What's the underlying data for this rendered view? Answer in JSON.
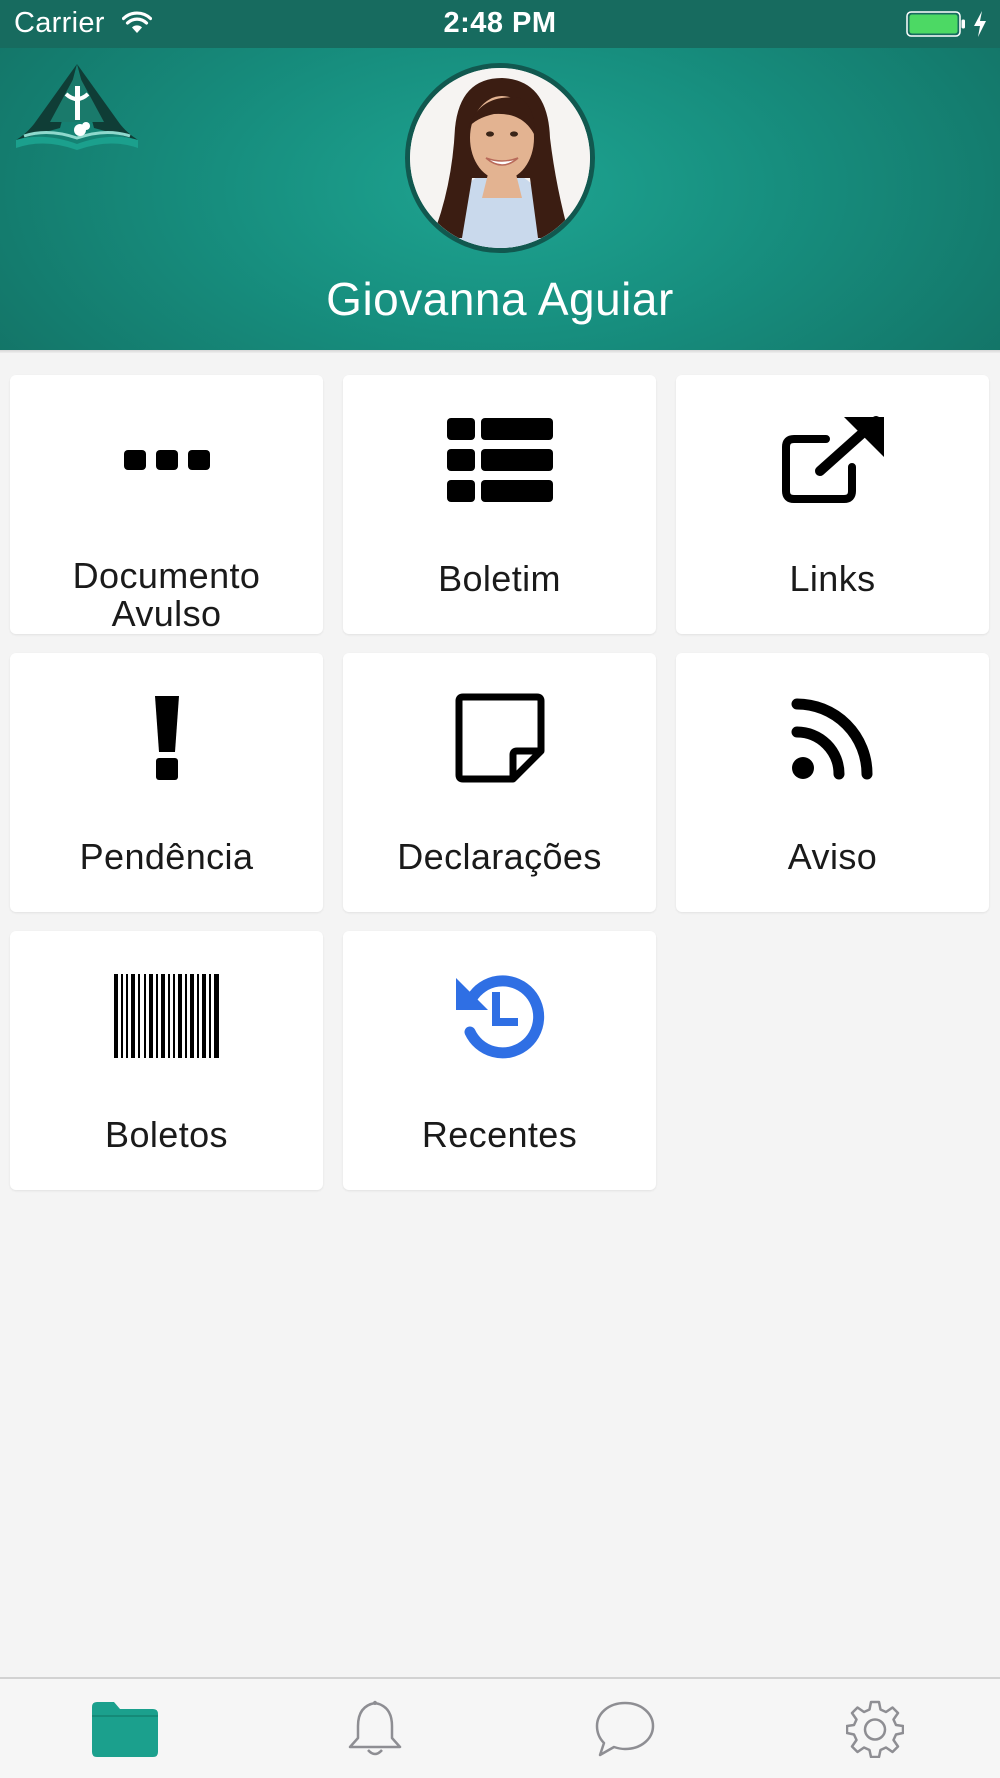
{
  "status_bar": {
    "carrier": "Carrier",
    "time": "2:48 PM"
  },
  "header": {
    "user_name": "Giovanna Aguiar",
    "logo_icon": "school-logo-icon",
    "avatar": "user-avatar-photo"
  },
  "menu": {
    "items": [
      {
        "label": "Documento Avulso",
        "icon": "more-dots-icon"
      },
      {
        "label": "Boletim",
        "icon": "list-icon"
      },
      {
        "label": "Links",
        "icon": "external-link-icon"
      },
      {
        "label": "Pendência",
        "icon": "exclamation-icon"
      },
      {
        "label": "Declarações",
        "icon": "sticky-note-icon"
      },
      {
        "label": "Aviso",
        "icon": "rss-feed-icon"
      },
      {
        "label": "Boletos",
        "icon": "barcode-icon"
      },
      {
        "label": "Recentes",
        "icon": "history-icon"
      }
    ]
  },
  "tab_bar": {
    "tabs": [
      {
        "icon": "folder-icon",
        "active": true
      },
      {
        "icon": "bell-icon",
        "active": false
      },
      {
        "icon": "chat-bubble-icon",
        "active": false
      },
      {
        "icon": "gear-icon",
        "active": false
      }
    ]
  },
  "colors": {
    "header": "#178f7f",
    "status_bar": "#176b5f",
    "accent": "#1ba08d",
    "recent_icon": "#2f6fe4",
    "battery": "#4cd964"
  }
}
